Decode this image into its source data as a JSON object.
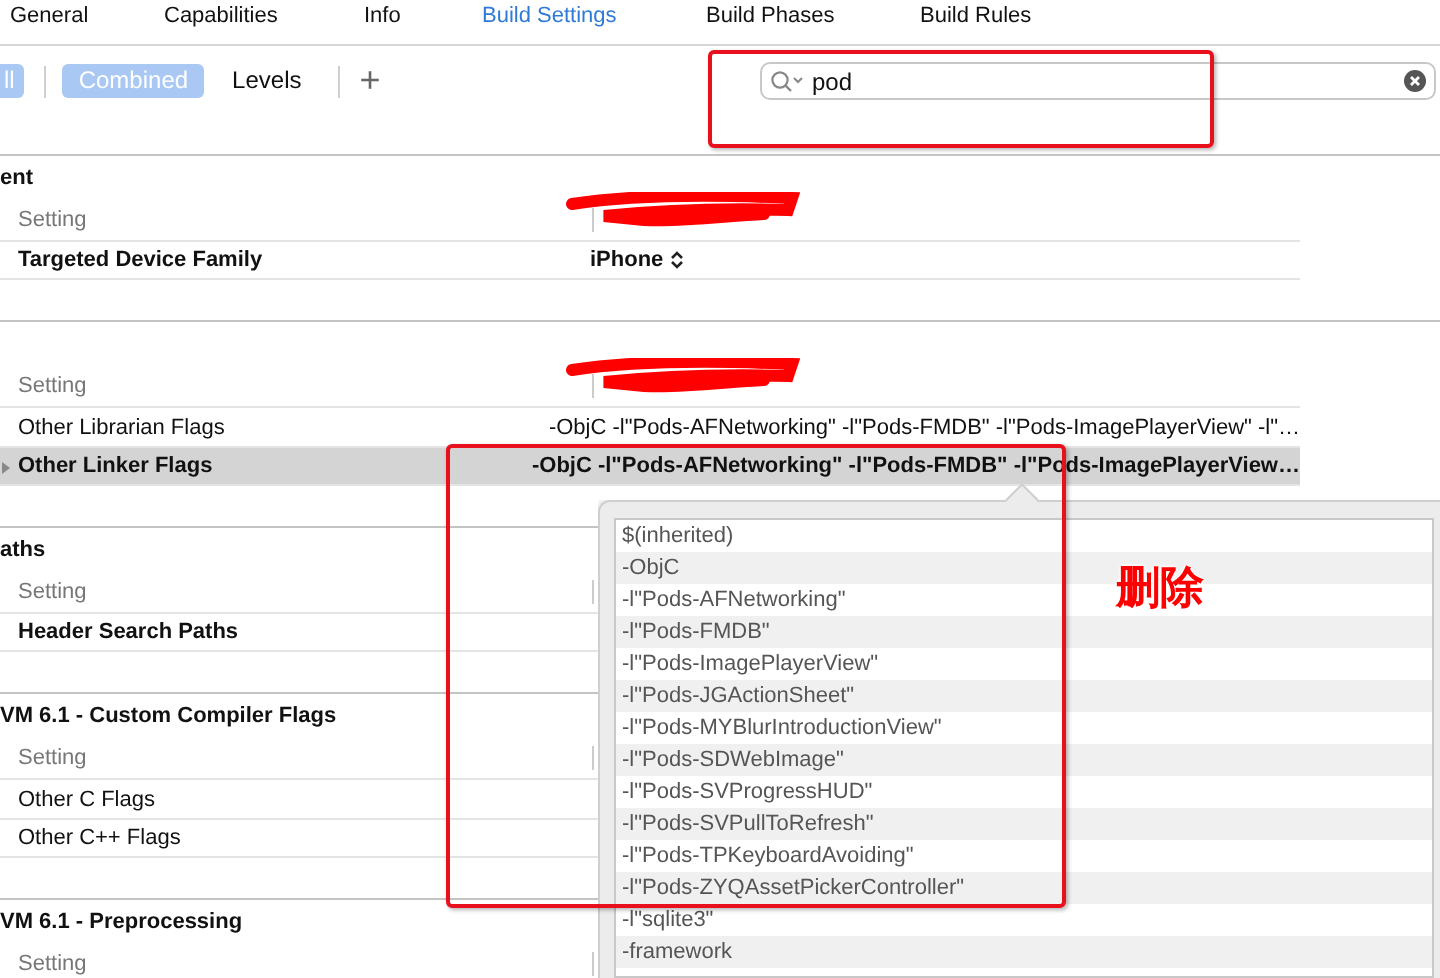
{
  "tabs": [
    {
      "label": "General",
      "selected": false
    },
    {
      "label": "Capabilities",
      "selected": false
    },
    {
      "label": "Info",
      "selected": false
    },
    {
      "label": "Build Settings",
      "selected": true
    },
    {
      "label": "Build Phases",
      "selected": false
    },
    {
      "label": "Build Rules",
      "selected": false
    }
  ],
  "toolbar": {
    "buttons": [
      {
        "label": "ll",
        "selected": true
      },
      {
        "label": "Combined",
        "selected": true
      },
      {
        "label": "Levels",
        "selected": false
      }
    ],
    "add_label": "+"
  },
  "search": {
    "value": "pod"
  },
  "sections": [
    {
      "title": "ent",
      "header": "Setting",
      "redacted": true,
      "rows": [
        {
          "name": "Targeted Device Family",
          "value": "iPhone",
          "kind": "popup",
          "modified": true,
          "selected": false
        }
      ]
    },
    {
      "header": "Setting",
      "redacted": true,
      "rows": [
        {
          "name": "Other Librarian Flags",
          "value": "-ObjC -l\"Pods-AFNetworking\" -l\"Pods-FMDB\" -l\"Pods-ImagePlayerView\" -l\"…",
          "kind": "text",
          "modified": false,
          "selected": false
        },
        {
          "name": "Other Linker Flags",
          "value": "-ObjC -l\"Pods-AFNetworking\" -l\"Pods-FMDB\" -l\"Pods-ImagePlayerView…",
          "kind": "text",
          "modified": true,
          "selected": true
        }
      ]
    },
    {
      "title": "aths",
      "header": "Setting",
      "rows": [
        {
          "name": "Header Search Paths",
          "kind": "text",
          "modified": true,
          "selected": false
        }
      ]
    },
    {
      "title": "VM 6.1 - Custom Compiler Flags",
      "header": "Setting",
      "rows": [
        {
          "name": "Other C Flags",
          "kind": "text",
          "modified": false,
          "selected": false
        },
        {
          "name": "Other C++ Flags",
          "kind": "text",
          "modified": false,
          "selected": false
        }
      ]
    },
    {
      "title": "VM 6.1 - Preprocessing",
      "header": "Setting"
    }
  ],
  "popover": {
    "items": [
      "$(inherited)",
      "-ObjC",
      "-l\"Pods-AFNetworking\"",
      "-l\"Pods-FMDB\"",
      "-l\"Pods-ImagePlayerView\"",
      "-l\"Pods-JGActionSheet\"",
      "-l\"Pods-MYBlurIntroductionView\"",
      "-l\"Pods-SDWebImage\"",
      "-l\"Pods-SVProgressHUD\"",
      "-l\"Pods-SVPullToRefresh\"",
      "-l\"Pods-TPKeyboardAvoiding\"",
      "-l\"Pods-ZYQAssetPickerController\"",
      "-l\"sqlite3\"",
      "-framework"
    ]
  },
  "annotation": {
    "label": "删除"
  }
}
